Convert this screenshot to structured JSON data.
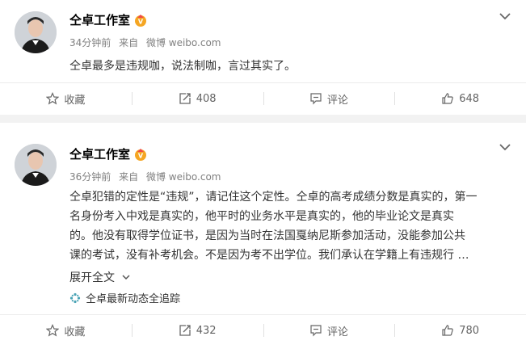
{
  "posts": [
    {
      "author": "仝卓工作室",
      "time": "34分钟前",
      "via_prefix": "来自",
      "via": "微博 weibo.com",
      "content": "仝卓最多是违规咖，说法制咖，言过其实了。",
      "actions": {
        "favorite": "收藏",
        "repost": "408",
        "comment": "评论",
        "like": "648"
      }
    },
    {
      "author": "仝卓工作室",
      "time": "36分钟前",
      "via_prefix": "来自",
      "via": "微博 weibo.com",
      "content_lines": [
        "仝卓犯错的定性是“违规”，请记住这个定性。仝卓的高考成绩分数是真实的，第一",
        "名身份考入中戏是真实的，他平时的业务水平是真实的，他的毕业论文是真实",
        "的。他没有取得学位证书，是因为当时在法国戛纳尼斯参加活动，没能参加公共",
        "课的考试，没有补考机会。不是因为考不出学位。我们承认在学籍上有违规行 …"
      ],
      "expand_label": "展开全文",
      "source_tag": "仝卓最新动态全追踪",
      "actions": {
        "favorite": "收藏",
        "repost": "432",
        "comment": "评论",
        "like": "780"
      }
    }
  ],
  "colors": {
    "meta": "#808080",
    "accent_orange": "#f5a623",
    "link_green": "#507a9c"
  },
  "icons": [
    "star-icon",
    "repost-icon",
    "comment-icon",
    "like-icon",
    "chevron-down-icon",
    "vip-badge-icon",
    "sparkle-icon"
  ]
}
